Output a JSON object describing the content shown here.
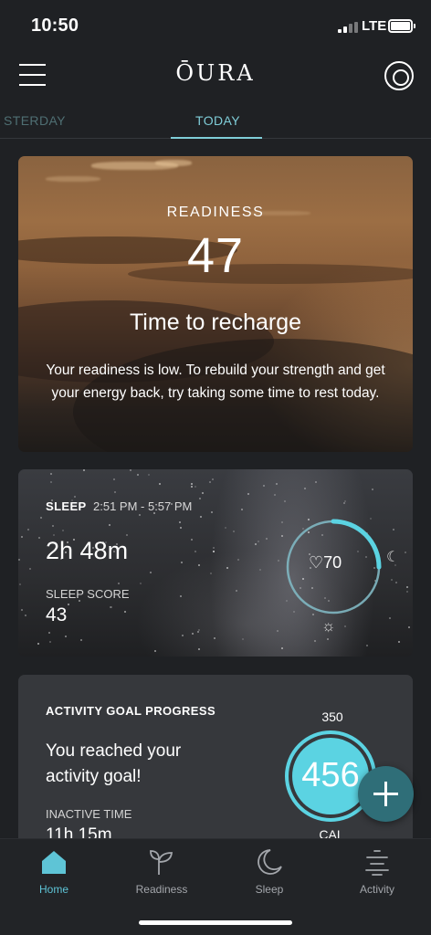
{
  "status_bar": {
    "time": "10:50",
    "network": "LTE"
  },
  "header": {
    "logo": "ŌURA"
  },
  "tabs": [
    {
      "label": "STERDAY",
      "active": false
    },
    {
      "label": "TODAY",
      "active": true
    }
  ],
  "readiness": {
    "label": "READINESS",
    "score": "47",
    "headline": "Time to recharge",
    "body": "Your readiness is low. To rebuild your strength and get your energy back, try taking some time to rest today."
  },
  "sleep": {
    "title": "SLEEP",
    "time_range": "2:51 PM - 5:57 PM",
    "duration": "2h 48m",
    "score_label": "SLEEP SCORE",
    "score": "43",
    "heart_rate": "70",
    "ring_progress": 0.25,
    "moon_icon": "moon-icon",
    "sun_icon": "sun-icon"
  },
  "activity": {
    "title": "ACTIVITY GOAL PROGRESS",
    "message": "You reached your activity goal!",
    "inactive_label": "INACTIVE TIME",
    "inactive_value": "11h 15m",
    "goal": "350",
    "calories": "456",
    "calories_unit": "CAL"
  },
  "fab": {
    "icon": "plus-icon"
  },
  "bottom_nav": [
    {
      "label": "Home",
      "icon": "home-icon",
      "active": true
    },
    {
      "label": "Readiness",
      "icon": "sprout-icon",
      "active": false
    },
    {
      "label": "Sleep",
      "icon": "moon-icon",
      "active": false
    },
    {
      "label": "Activity",
      "icon": "activity-icon",
      "active": false
    }
  ],
  "colors": {
    "accent": "#5ec4d6",
    "ring": "#5bd3e2",
    "background": "#1f2124",
    "card": "#36383c",
    "fab": "#2f6e78"
  }
}
